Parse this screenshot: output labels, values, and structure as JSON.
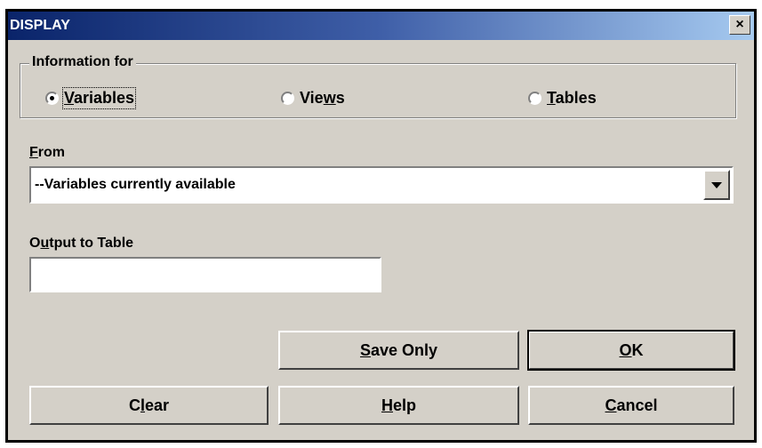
{
  "window": {
    "title": "DISPLAY",
    "close_label": "×"
  },
  "info_group": {
    "legend": "Information for",
    "radios": [
      {
        "pre": "",
        "mnemonic": "V",
        "post": "ariables",
        "selected": true
      },
      {
        "pre": "Vie",
        "mnemonic": "w",
        "post": "s",
        "selected": false
      },
      {
        "pre": "",
        "mnemonic": "T",
        "post": "ables",
        "selected": false
      }
    ]
  },
  "from": {
    "label_mnemonic": "F",
    "label_rest": "rom",
    "value": "--Variables currently available"
  },
  "output": {
    "label_pre": "O",
    "label_mnemonic": "u",
    "label_rest": "tput to Table",
    "value": ""
  },
  "buttons": {
    "save_only": {
      "mnemonic": "S",
      "rest": "ave Only"
    },
    "ok": {
      "mnemonic": "O",
      "rest": "K"
    },
    "clear": {
      "pre": "C",
      "mnemonic": "l",
      "rest": "ear"
    },
    "help": {
      "mnemonic": "H",
      "rest": "elp"
    },
    "cancel": {
      "mnemonic": "C",
      "rest": "ancel"
    }
  }
}
